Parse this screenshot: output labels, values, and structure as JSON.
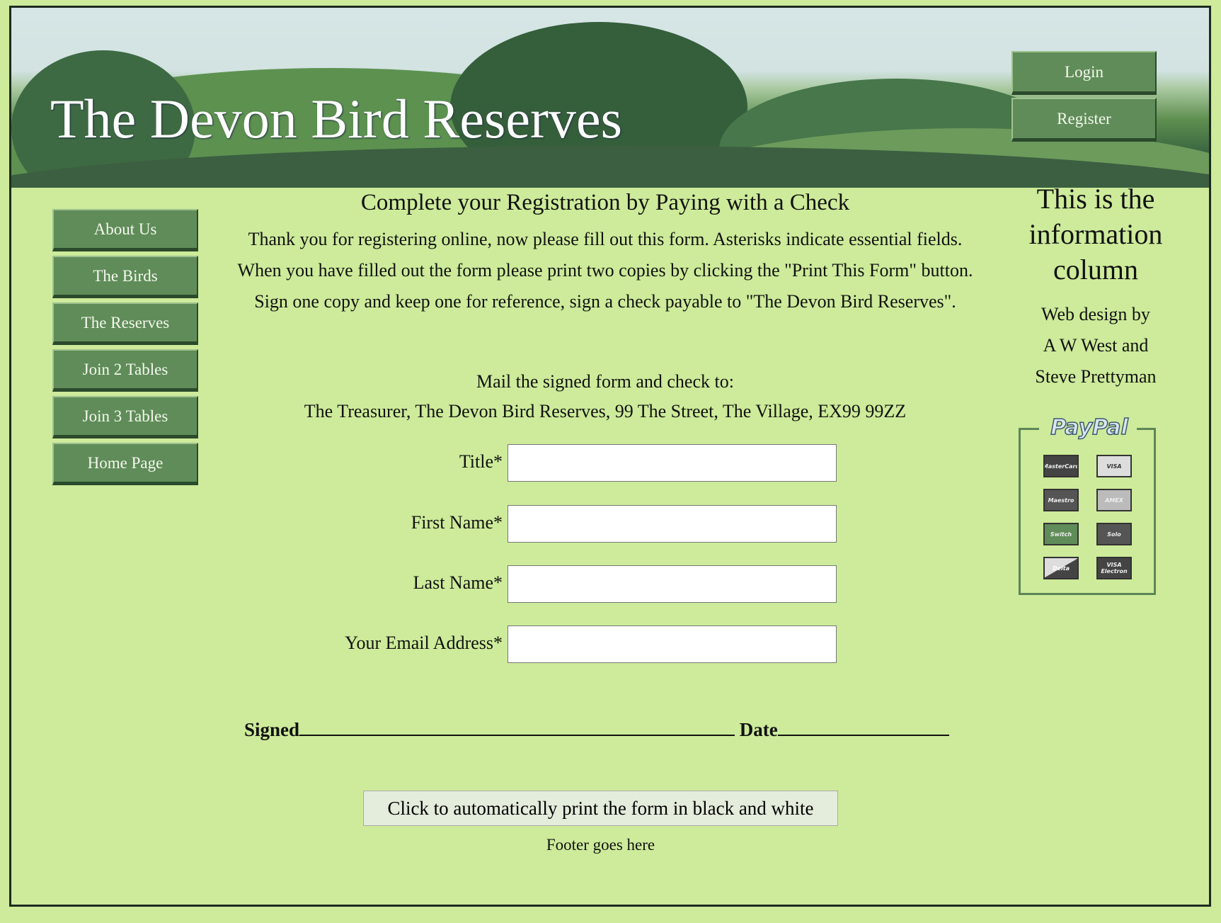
{
  "header": {
    "site_title": "The Devon Bird Reserves",
    "login": "Login",
    "register": "Register"
  },
  "nav": [
    {
      "label": "About Us"
    },
    {
      "label": "The Birds"
    },
    {
      "label": "The Reserves"
    },
    {
      "label": "Join 2 Tables"
    },
    {
      "label": "Join 3 Tables"
    },
    {
      "label": "Home Page"
    }
  ],
  "main": {
    "heading": "Complete your Registration by Paying with a Check",
    "intro": "Thank you for registering online, now please fill out this form. Asterisks indicate essential fields. When you have filled out the form please print two copies by clicking the \"Print This Form\" button. Sign one copy and keep one for reference, sign a check payable to \"The Devon Bird Reserves\".",
    "mail_line1": "Mail the signed form and check to:",
    "mail_line2": "The Treasurer, The Devon Bird Reserves, 99 The Street, The Village, EX99 99ZZ",
    "fields": [
      {
        "label": "Title*",
        "value": ""
      },
      {
        "label": "First Name*",
        "value": ""
      },
      {
        "label": "Last Name*",
        "value": ""
      },
      {
        "label": "Your Email Address*",
        "value": ""
      }
    ],
    "signed_label": "Signed",
    "date_label": "Date",
    "print_button": "Click to automatically print the form in black and white",
    "footer": "Footer goes here"
  },
  "info": {
    "title": "This is the information column",
    "credit_line1": "Web design by",
    "credit_line2": "A W West and",
    "credit_line3": "Steve Prettyman",
    "paypal": "PayPal",
    "cards": [
      "MasterCard",
      "VISA",
      "Maestro",
      "AMEX",
      "Switch",
      "Solo",
      "Delta",
      "VISA Electron"
    ]
  },
  "colors": {
    "background": "#cdeb9a",
    "button": "#5f8c58",
    "border": "#1d2b22"
  }
}
